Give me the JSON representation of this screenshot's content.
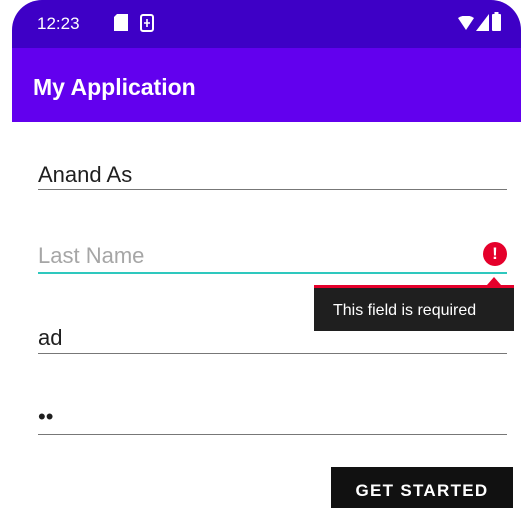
{
  "status_bar": {
    "time": "12:23",
    "icons": [
      "sd-card-icon",
      "sim-icon",
      "wifi-icon",
      "signal-icon",
      "battery-icon"
    ]
  },
  "app_bar": {
    "title": "My Application",
    "color": "#6200ee",
    "status_color": "#3e00c6"
  },
  "form": {
    "first_name": {
      "value": "Anand As"
    },
    "last_name": {
      "value": "",
      "placeholder": "Last Name",
      "error": "This field is required"
    },
    "third_field": {
      "value": "ad"
    },
    "password": {
      "value": "••"
    }
  },
  "actions": {
    "get_started_label": "GET STARTED"
  },
  "colors": {
    "accent": "#2ec8be",
    "error": "#e5002b"
  }
}
